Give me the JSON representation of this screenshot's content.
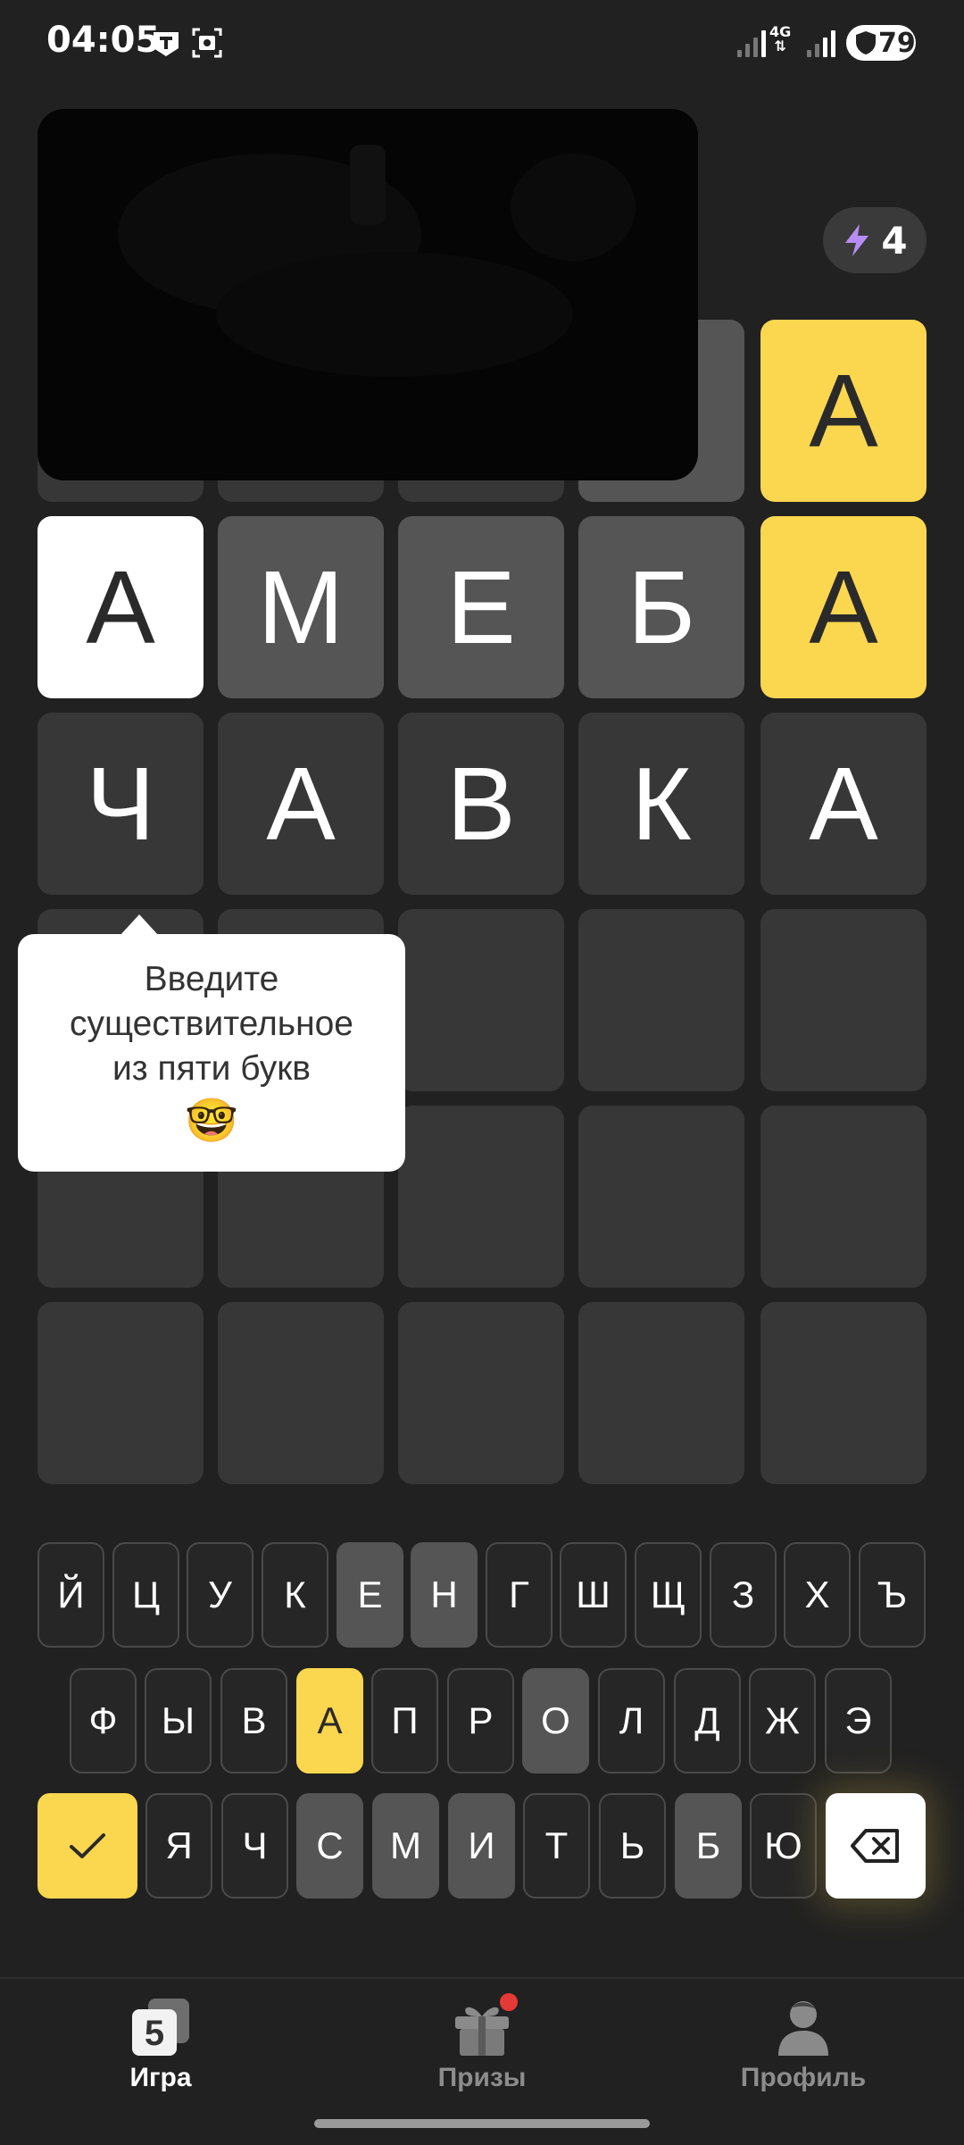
{
  "status_bar": {
    "time": "04:05",
    "network": "4G",
    "battery": "79"
  },
  "energy": {
    "count": "4"
  },
  "board": {
    "rows": [
      [
        {
          "letter": "",
          "state": "hidden"
        },
        {
          "letter": "",
          "state": "hidden"
        },
        {
          "letter": "",
          "state": "hidden"
        },
        {
          "letter": "",
          "state": "gray"
        },
        {
          "letter": "А",
          "state": "yellow"
        }
      ],
      [
        {
          "letter": "А",
          "state": "white"
        },
        {
          "letter": "М",
          "state": "gray"
        },
        {
          "letter": "Е",
          "state": "gray"
        },
        {
          "letter": "Б",
          "state": "gray"
        },
        {
          "letter": "А",
          "state": "yellow"
        }
      ],
      [
        {
          "letter": "Ч",
          "state": "empty"
        },
        {
          "letter": "А",
          "state": "empty"
        },
        {
          "letter": "В",
          "state": "empty"
        },
        {
          "letter": "К",
          "state": "empty"
        },
        {
          "letter": "А",
          "state": "empty"
        }
      ],
      [
        {
          "letter": "",
          "state": "empty"
        },
        {
          "letter": "",
          "state": "empty"
        },
        {
          "letter": "",
          "state": "empty"
        },
        {
          "letter": "",
          "state": "empty"
        },
        {
          "letter": "",
          "state": "empty"
        }
      ],
      [
        {
          "letter": "",
          "state": "empty"
        },
        {
          "letter": "",
          "state": "empty"
        },
        {
          "letter": "",
          "state": "empty"
        },
        {
          "letter": "",
          "state": "empty"
        },
        {
          "letter": "",
          "state": "empty"
        }
      ],
      [
        {
          "letter": "",
          "state": "empty"
        },
        {
          "letter": "",
          "state": "empty"
        },
        {
          "letter": "",
          "state": "empty"
        },
        {
          "letter": "",
          "state": "empty"
        },
        {
          "letter": "",
          "state": "empty"
        }
      ]
    ]
  },
  "tooltip": {
    "line1": "Введите",
    "line2": "существительное",
    "line3": "из пяти букв",
    "emoji": "🤓"
  },
  "keyboard": {
    "row1": [
      {
        "key": "Й",
        "state": "default"
      },
      {
        "key": "Ц",
        "state": "default"
      },
      {
        "key": "У",
        "state": "default"
      },
      {
        "key": "К",
        "state": "default"
      },
      {
        "key": "Е",
        "state": "gray"
      },
      {
        "key": "Н",
        "state": "gray"
      },
      {
        "key": "Г",
        "state": "default"
      },
      {
        "key": "Ш",
        "state": "default"
      },
      {
        "key": "Щ",
        "state": "default"
      },
      {
        "key": "З",
        "state": "default"
      },
      {
        "key": "Х",
        "state": "default"
      },
      {
        "key": "Ъ",
        "state": "default"
      }
    ],
    "row2": [
      {
        "key": "Ф",
        "state": "default"
      },
      {
        "key": "Ы",
        "state": "default"
      },
      {
        "key": "В",
        "state": "default"
      },
      {
        "key": "А",
        "state": "yellow"
      },
      {
        "key": "П",
        "state": "default"
      },
      {
        "key": "Р",
        "state": "default"
      },
      {
        "key": "О",
        "state": "gray"
      },
      {
        "key": "Л",
        "state": "default"
      },
      {
        "key": "Д",
        "state": "default"
      },
      {
        "key": "Ж",
        "state": "default"
      },
      {
        "key": "Э",
        "state": "default"
      }
    ],
    "row3": [
      {
        "key": "Я",
        "state": "default"
      },
      {
        "key": "Ч",
        "state": "default"
      },
      {
        "key": "С",
        "state": "gray"
      },
      {
        "key": "М",
        "state": "gray"
      },
      {
        "key": "И",
        "state": "gray"
      },
      {
        "key": "Т",
        "state": "default"
      },
      {
        "key": "Ь",
        "state": "default"
      },
      {
        "key": "Б",
        "state": "gray"
      },
      {
        "key": "Ю",
        "state": "default"
      }
    ],
    "submit_icon": "check-icon",
    "backspace_icon": "backspace-icon"
  },
  "nav": {
    "game": "Игра",
    "prizes": "Призы",
    "profile": "Профиль"
  },
  "colors": {
    "background": "#212121",
    "tile_empty": "#373737",
    "tile_absent": "#555555",
    "tile_correct": "#fbd64f",
    "tile_present": "#ffffff",
    "notification": "#e53935"
  }
}
